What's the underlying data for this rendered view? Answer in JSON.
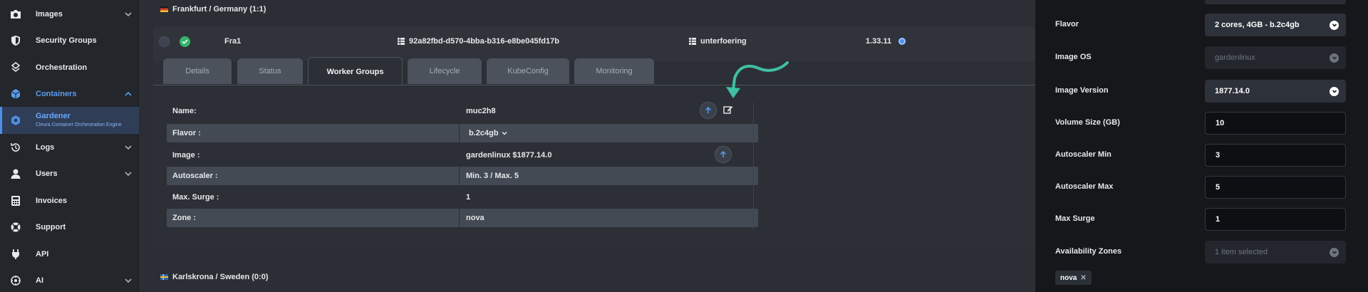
{
  "sidebar": {
    "items": [
      {
        "label": "Images",
        "icon": "camera-icon"
      },
      {
        "label": "Security Groups",
        "icon": "shield-icon"
      },
      {
        "label": "Orchestration",
        "icon": "orchestration-icon"
      },
      {
        "label": "Containers",
        "icon": "cube-icon"
      },
      {
        "label": "Gardener",
        "sub": "Cleura Container Orchestration Engine",
        "icon": "gardener-icon"
      },
      {
        "label": "Logs",
        "icon": "history-icon"
      },
      {
        "label": "Users",
        "icon": "user-icon"
      },
      {
        "label": "Invoices",
        "icon": "calculator-icon"
      },
      {
        "label": "Support",
        "icon": "lifebuoy-icon"
      },
      {
        "label": "API",
        "icon": "plug-icon"
      },
      {
        "label": "AI",
        "icon": "ai-icon"
      }
    ]
  },
  "region_top": {
    "label": "Frankfurt / Germany (1:1)"
  },
  "region_bottom": {
    "label": "Karlskrona / Sweden (0:0)"
  },
  "cluster": {
    "name": "Fra1",
    "id": "92a82fbd-d570-4bba-b316-e8be045fd17b",
    "project": "unterfoering",
    "version": "1.33.11"
  },
  "tabs": [
    "Details",
    "Status",
    "Worker Groups",
    "Lifecycle",
    "KubeConfig",
    "Monitoring"
  ],
  "active_tab": "Worker Groups",
  "worker_group": {
    "name_key": "Name:",
    "name_val": "muc2h8",
    "flavor_key": "Flavor :",
    "flavor_val": "b.2c4gb",
    "image_key": "Image :",
    "image_val": "gardenlinux $1877.14.0",
    "autoscaler_key": "Autoscaler :",
    "autoscaler_val": "Min. 3 / Max. 5",
    "surge_key": "Max. Surge :",
    "surge_val": "1",
    "zone_key": "Zone :",
    "zone_val": "nova"
  },
  "panel": {
    "flavor_label": "Flavor",
    "flavor_value": "2 cores, 4GB - b.2c4gb",
    "image_os_label": "Image OS",
    "image_os_value": "gardenlinux",
    "image_version_label": "Image Version",
    "image_version_value": "1877.14.0",
    "volume_label": "Volume Size (GB)",
    "volume_value": "10",
    "asmin_label": "Autoscaler Min",
    "asmin_value": "3",
    "asmax_label": "Autoscaler Max",
    "asmax_value": "5",
    "surge_label": "Max Surge",
    "surge_value": "1",
    "zones_label": "Availability Zones",
    "zones_value": "1 item selected",
    "zone_chip": "nova"
  },
  "colors": {
    "accent": "#4e8fe8",
    "success": "#35b36c",
    "annotation": "#3fbfa3"
  }
}
